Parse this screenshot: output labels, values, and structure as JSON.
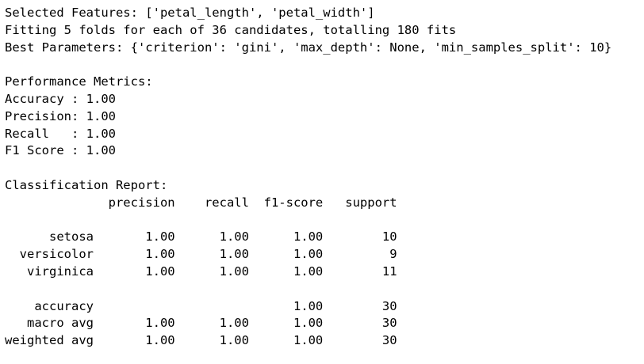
{
  "console_output": {
    "lines": [
      "Selected Features: ['petal_length', 'petal_width']",
      "Fitting 5 folds for each of 36 candidates, totalling 180 fits",
      "Best Parameters: {'criterion': 'gini', 'max_depth': None, 'min_samples_split': 10}",
      "",
      "Performance Metrics:",
      "Accuracy : 1.00",
      "Precision: 1.00",
      "Recall   : 1.00",
      "F1 Score : 1.00",
      "",
      "Classification Report:",
      "              precision    recall  f1-score   support",
      "",
      "      setosa       1.00      1.00      1.00        10",
      "  versicolor       1.00      1.00      1.00         9",
      "   virginica       1.00      1.00      1.00        11",
      "",
      "    accuracy                           1.00        30",
      "   macro avg       1.00      1.00      1.00        30",
      "weighted avg       1.00      1.00      1.00        30"
    ]
  }
}
